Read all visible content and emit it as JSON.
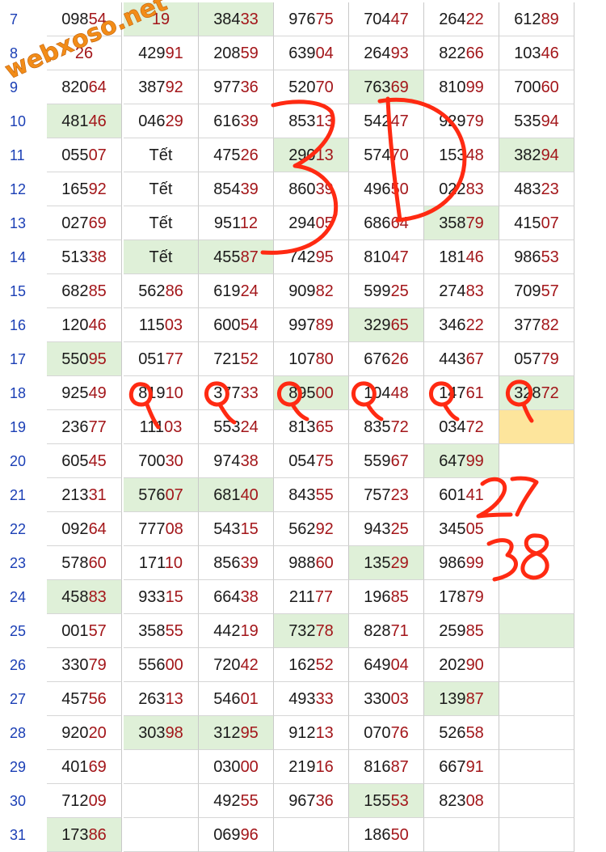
{
  "watermark": "webxoso.net",
  "rows": [
    {
      "n": "7",
      "c": [
        [
          "098",
          "54",
          ""
        ],
        [
          "",
          "19",
          "hl"
        ],
        [
          "384",
          "33",
          "hl"
        ],
        [
          "976",
          "75",
          ""
        ],
        [
          "704",
          "47",
          ""
        ],
        [
          "264",
          "22",
          ""
        ],
        [
          "612",
          "89",
          ""
        ]
      ]
    },
    {
      "n": "8",
      "c": [
        [
          "",
          "26",
          ""
        ],
        [
          "429",
          "91",
          ""
        ],
        [
          "208",
          "59",
          ""
        ],
        [
          "639",
          "04",
          ""
        ],
        [
          "264",
          "93",
          ""
        ],
        [
          "822",
          "66",
          ""
        ],
        [
          "103",
          "46",
          ""
        ]
      ]
    },
    {
      "n": "9",
      "c": [
        [
          "820",
          "64",
          ""
        ],
        [
          "387",
          "92",
          ""
        ],
        [
          "977",
          "36",
          ""
        ],
        [
          "520",
          "70",
          ""
        ],
        [
          "763",
          "69",
          "hl"
        ],
        [
          "810",
          "99",
          ""
        ],
        [
          "700",
          "60",
          ""
        ]
      ]
    },
    {
      "n": "10",
      "c": [
        [
          "481",
          "46",
          "hl"
        ],
        [
          "046",
          "29",
          ""
        ],
        [
          "616",
          "39",
          ""
        ],
        [
          "853",
          "13",
          ""
        ],
        [
          "542",
          "47",
          ""
        ],
        [
          "929",
          "79",
          ""
        ],
        [
          "535",
          "94",
          ""
        ]
      ]
    },
    {
      "n": "11",
      "c": [
        [
          "055",
          "07",
          ""
        ],
        [
          "Tết",
          "",
          ""
        ],
        [
          "475",
          "26",
          ""
        ],
        [
          "290",
          "13",
          "hl"
        ],
        [
          "574",
          "70",
          ""
        ],
        [
          "153",
          "48",
          ""
        ],
        [
          "382",
          "94",
          "hl"
        ]
      ]
    },
    {
      "n": "12",
      "c": [
        [
          "165",
          "92",
          ""
        ],
        [
          "Tết",
          "",
          ""
        ],
        [
          "854",
          "39",
          ""
        ],
        [
          "860",
          "39",
          ""
        ],
        [
          "496",
          "50",
          ""
        ],
        [
          "022",
          "83",
          ""
        ],
        [
          "483",
          "23",
          ""
        ]
      ]
    },
    {
      "n": "13",
      "c": [
        [
          "027",
          "69",
          ""
        ],
        [
          "Tết",
          "",
          ""
        ],
        [
          "951",
          "12",
          ""
        ],
        [
          "294",
          "05",
          ""
        ],
        [
          "686",
          "64",
          ""
        ],
        [
          "358",
          "79",
          "hl"
        ],
        [
          "415",
          "07",
          ""
        ]
      ]
    },
    {
      "n": "14",
      "c": [
        [
          "513",
          "38",
          ""
        ],
        [
          "Tết",
          "",
          "hl"
        ],
        [
          "455",
          "87",
          "hl"
        ],
        [
          "742",
          "95",
          ""
        ],
        [
          "810",
          "47",
          ""
        ],
        [
          "181",
          "46",
          ""
        ],
        [
          "986",
          "53",
          ""
        ]
      ]
    },
    {
      "n": "15",
      "c": [
        [
          "682",
          "85",
          ""
        ],
        [
          "562",
          "86",
          ""
        ],
        [
          "619",
          "24",
          ""
        ],
        [
          "909",
          "82",
          ""
        ],
        [
          "599",
          "25",
          ""
        ],
        [
          "274",
          "83",
          ""
        ],
        [
          "709",
          "57",
          ""
        ]
      ]
    },
    {
      "n": "16",
      "c": [
        [
          "120",
          "46",
          ""
        ],
        [
          "115",
          "03",
          ""
        ],
        [
          "600",
          "54",
          ""
        ],
        [
          "997",
          "89",
          ""
        ],
        [
          "329",
          "65",
          "hl"
        ],
        [
          "346",
          "22",
          ""
        ],
        [
          "377",
          "82",
          ""
        ]
      ]
    },
    {
      "n": "17",
      "c": [
        [
          "550",
          "95",
          "hl"
        ],
        [
          "051",
          "77",
          ""
        ],
        [
          "721",
          "52",
          ""
        ],
        [
          "107",
          "80",
          ""
        ],
        [
          "676",
          "26",
          ""
        ],
        [
          "443",
          "67",
          ""
        ],
        [
          "057",
          "79",
          ""
        ]
      ]
    },
    {
      "n": "18",
      "c": [
        [
          "925",
          "49",
          ""
        ],
        [
          "819",
          "10",
          ""
        ],
        [
          "377",
          "33",
          ""
        ],
        [
          "895",
          "00",
          "hl"
        ],
        [
          "104",
          "48",
          ""
        ],
        [
          "147",
          "61",
          ""
        ],
        [
          "328",
          "72",
          "hl"
        ]
      ]
    },
    {
      "n": "19",
      "c": [
        [
          "236",
          "77",
          ""
        ],
        [
          "111",
          "03",
          ""
        ],
        [
          "553",
          "24",
          ""
        ],
        [
          "813",
          "65",
          ""
        ],
        [
          "835",
          "72",
          ""
        ],
        [
          "034",
          "72",
          ""
        ],
        [
          "",
          "",
          "yel"
        ]
      ]
    },
    {
      "n": "20",
      "c": [
        [
          "605",
          "45",
          ""
        ],
        [
          "700",
          "30",
          ""
        ],
        [
          "974",
          "38",
          ""
        ],
        [
          "054",
          "75",
          ""
        ],
        [
          "559",
          "67",
          ""
        ],
        [
          "647",
          "99",
          "hl"
        ],
        [
          "",
          "",
          ""
        ]
      ]
    },
    {
      "n": "21",
      "c": [
        [
          "213",
          "31",
          ""
        ],
        [
          "576",
          "07",
          "hl"
        ],
        [
          "681",
          "40",
          "hl"
        ],
        [
          "843",
          "55",
          ""
        ],
        [
          "757",
          "23",
          ""
        ],
        [
          "601",
          "41",
          ""
        ],
        [
          "",
          "",
          ""
        ]
      ]
    },
    {
      "n": "22",
      "c": [
        [
          "092",
          "64",
          ""
        ],
        [
          "777",
          "08",
          ""
        ],
        [
          "543",
          "15",
          ""
        ],
        [
          "562",
          "92",
          ""
        ],
        [
          "943",
          "25",
          ""
        ],
        [
          "345",
          "05",
          ""
        ],
        [
          "",
          "",
          ""
        ]
      ]
    },
    {
      "n": "23",
      "c": [
        [
          "578",
          "60",
          ""
        ],
        [
          "171",
          "10",
          ""
        ],
        [
          "856",
          "39",
          ""
        ],
        [
          "988",
          "60",
          ""
        ],
        [
          "135",
          "29",
          "hl"
        ],
        [
          "986",
          "99",
          ""
        ],
        [
          "",
          "",
          ""
        ]
      ]
    },
    {
      "n": "24",
      "c": [
        [
          "458",
          "83",
          "hl"
        ],
        [
          "933",
          "15",
          ""
        ],
        [
          "664",
          "38",
          ""
        ],
        [
          "211",
          "77",
          ""
        ],
        [
          "196",
          "85",
          ""
        ],
        [
          "178",
          "79",
          ""
        ],
        [
          "",
          "",
          ""
        ]
      ]
    },
    {
      "n": "25",
      "c": [
        [
          "001",
          "57",
          ""
        ],
        [
          "358",
          "55",
          ""
        ],
        [
          "442",
          "19",
          ""
        ],
        [
          "732",
          "78",
          "hl"
        ],
        [
          "828",
          "71",
          ""
        ],
        [
          "259",
          "85",
          ""
        ],
        [
          "",
          "",
          "hl"
        ]
      ]
    },
    {
      "n": "26",
      "c": [
        [
          "330",
          "79",
          ""
        ],
        [
          "556",
          "00",
          ""
        ],
        [
          "720",
          "42",
          ""
        ],
        [
          "162",
          "52",
          ""
        ],
        [
          "649",
          "04",
          ""
        ],
        [
          "202",
          "90",
          ""
        ],
        [
          "",
          "",
          ""
        ]
      ]
    },
    {
      "n": "27",
      "c": [
        [
          "457",
          "56",
          ""
        ],
        [
          "263",
          "13",
          ""
        ],
        [
          "546",
          "01",
          ""
        ],
        [
          "493",
          "33",
          ""
        ],
        [
          "330",
          "03",
          ""
        ],
        [
          "139",
          "87",
          "hl"
        ],
        [
          "",
          "",
          ""
        ]
      ]
    },
    {
      "n": "28",
      "c": [
        [
          "920",
          "20",
          ""
        ],
        [
          "303",
          "98",
          "hl"
        ],
        [
          "312",
          "95",
          "hl"
        ],
        [
          "912",
          "13",
          ""
        ],
        [
          "070",
          "76",
          ""
        ],
        [
          "526",
          "58",
          ""
        ],
        [
          "",
          "",
          ""
        ]
      ]
    },
    {
      "n": "29",
      "c": [
        [
          "401",
          "69",
          ""
        ],
        [
          "",
          "",
          ""
        ],
        [
          "030",
          "00",
          ""
        ],
        [
          "219",
          "16",
          ""
        ],
        [
          "816",
          "87",
          ""
        ],
        [
          "667",
          "91",
          ""
        ],
        [
          "",
          "",
          ""
        ]
      ]
    },
    {
      "n": "30",
      "c": [
        [
          "712",
          "09",
          ""
        ],
        [
          "",
          "",
          ""
        ],
        [
          "492",
          "55",
          ""
        ],
        [
          "967",
          "36",
          ""
        ],
        [
          "155",
          "53",
          "hl"
        ],
        [
          "823",
          "08",
          ""
        ],
        [
          "",
          "",
          ""
        ]
      ]
    },
    {
      "n": "31",
      "c": [
        [
          "173",
          "86",
          "hl"
        ],
        [
          "",
          "",
          ""
        ],
        [
          "069",
          "96",
          ""
        ],
        [
          "",
          "",
          ""
        ],
        [
          "186",
          "50",
          ""
        ],
        [
          "",
          "",
          ""
        ],
        [
          "",
          "",
          ""
        ]
      ]
    }
  ],
  "annotations": {
    "big_label": "3D",
    "numbers": [
      "27",
      "38"
    ],
    "marks": "circled row 18 digits"
  },
  "colors": {
    "highlight_green": "#dff0d8",
    "highlight_yellow": "#fde59c",
    "row_number_blue": "#1b3fb5",
    "last_two_red": "#a3161a",
    "ink_red": "#ff2a12",
    "watermark_orange": "#f28c18"
  }
}
